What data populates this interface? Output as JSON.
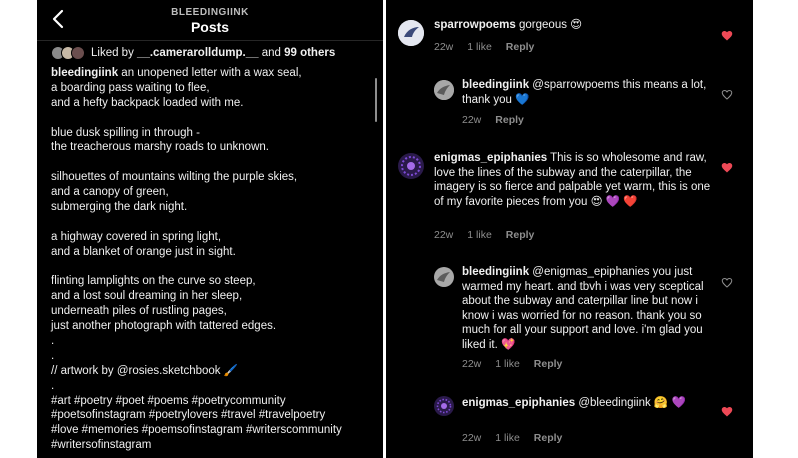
{
  "post": {
    "header_username": "BLEEDINGIINK",
    "header_title": "Posts",
    "likes": {
      "prefix": "Liked by",
      "user": "__.camerarolldump.__",
      "middle": "and",
      "others": "99 others"
    },
    "caption": {
      "author": "bleedingiink",
      "lines": [
        "an unopened letter with a wax seal,",
        "a boarding pass waiting to flee,",
        "and a hefty backpack loaded with me.",
        "",
        "blue dusk spilling in through -",
        "the treacherous marshy roads to unknown.",
        "",
        "silhouettes of mountains wilting the purple skies,",
        "and a canopy of green,",
        "submerging the dark night.",
        "",
        "a highway covered in spring light,",
        "and a blanket of orange just in sight.",
        "",
        "flinting lamplights on the curve so steep,",
        "and a lost soul dreaming in her sleep,",
        "underneath piles of rustling pages,",
        "just another photograph with tattered edges.",
        ".",
        ".",
        "// artwork by @rosies.sketchbook 🖌️",
        ".",
        "#art #poetry #poet #poems #poetrycommunity",
        "#poetsofinstagram #poetrylovers #travel #travelpoetry",
        "#love #memories #poemsofinstagram #writerscommunity",
        "#writersofinstagram"
      ]
    }
  },
  "comments": [
    {
      "user": "sparrowpoems",
      "text": "gorgeous 😍",
      "time": "22w",
      "likes": "1 like",
      "reply": "Reply",
      "liked": true
    },
    {
      "user": "bleedingiink",
      "text": "@sparrowpoems this means a lot, thank you 💙",
      "time": "22w",
      "reply": "Reply",
      "liked": false
    },
    {
      "user": "enigmas_epiphanies",
      "text": "This is so wholesome and raw, love the lines of the subway and the caterpillar, the imagery is so fierce and palpable yet warm, this is one of my favorite pieces from you 😍 💜 ❤️",
      "time": "22w",
      "likes": "1 like",
      "reply": "Reply",
      "liked": true
    },
    {
      "user": "bleedingiink",
      "text": "@enigmas_epiphanies you just warmed my heart. and tbvh i was very sceptical about the subway and caterpillar line but now i know i was worried for no reason. thank you so much for all your support and love. i'm glad you liked it. 💖",
      "time": "22w",
      "likes": "1 like",
      "reply": "Reply",
      "liked": false
    },
    {
      "user": "enigmas_epiphanies",
      "text": "@bleedingiink 🤗 💜",
      "time": "22w",
      "likes": "1 like",
      "reply": "Reply",
      "liked": true
    }
  ],
  "colors": {
    "background": "#000000",
    "text": "#f0f0f0",
    "muted": "#8e8e8e",
    "heart_liked": "#ed4956"
  }
}
